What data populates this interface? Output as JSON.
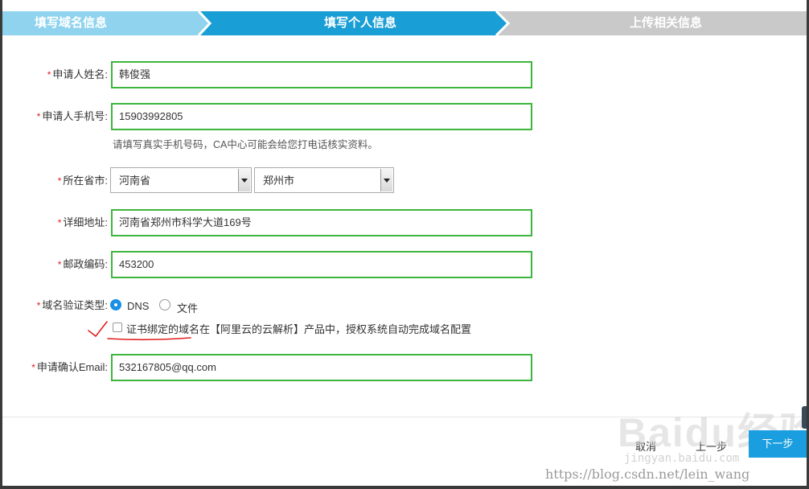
{
  "steps": [
    {
      "label": "填写域名信息",
      "state": "done"
    },
    {
      "label": "填写个人信息",
      "state": "active"
    },
    {
      "label": "上传相关信息",
      "state": "pending"
    }
  ],
  "colors": {
    "step_done": "#8fd3ee",
    "step_active": "#1a9ed6",
    "step_pending": "#c9c9c9",
    "field_border": "#3eb53e",
    "required": "#e02020",
    "primary": "#1a9ee0",
    "annotation": "#e02020"
  },
  "form": {
    "required_mark": "*",
    "name": {
      "label": "申请人姓名:",
      "value": "韩俊强"
    },
    "phone": {
      "label": "申请人手机号:",
      "value": "15903992805",
      "hint": "请填写真实手机号码，CA中心可能会给您打电话核实资料。"
    },
    "region": {
      "label": "所在省市:",
      "province": "河南省",
      "city": "郑州市"
    },
    "address": {
      "label": "详细地址:",
      "value": "河南省郑州市科学大道169号"
    },
    "postcode": {
      "label": "邮政编码:",
      "value": "453200"
    },
    "verify_type": {
      "label": "域名验证类型:",
      "options": [
        {
          "label": "DNS",
          "selected": true
        },
        {
          "label": "文件",
          "selected": false
        }
      ]
    },
    "auth_checkbox": {
      "label": "证书绑定的域名在【阿里云的云解析】产品中，授权系统自动完成域名配置",
      "checked": false
    },
    "email": {
      "label": "申请确认Email:",
      "value": "532167805@qq.com"
    }
  },
  "footer": {
    "cancel": "取消",
    "prev": "上一步",
    "next": "下一步"
  },
  "watermarks": {
    "baidu_logo": "Baidu经验",
    "baidu_url": "jingyan.baidu.com",
    "blog_url": "https://blog.csdn.net/lein_wang"
  }
}
